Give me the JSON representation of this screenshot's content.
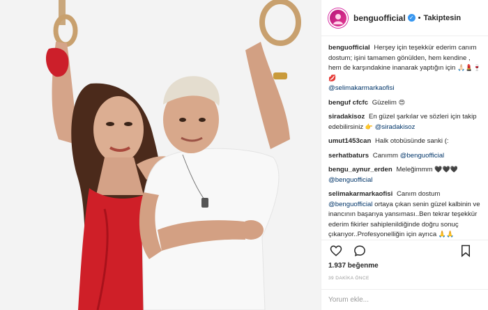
{
  "post": {
    "username": "benguofficial",
    "separator": "•",
    "follow_status": "Takiptesin",
    "likes": "1.937 beğenme",
    "time": "39 DAKİKA ÖNCE",
    "comment_placeholder": "Yorum ekle..."
  },
  "icons": {
    "verified": "verified-badge-icon",
    "like": "heart-icon",
    "comment": "speech-bubble-icon",
    "save": "bookmark-icon",
    "avatar": "profile-avatar"
  },
  "colors": {
    "mention": "#003569",
    "verified": "#3897f0",
    "muted": "#999999"
  },
  "comments": [
    {
      "user": "benguofficial",
      "text": "Herşey için teşekkür ederim canım dostum; işini tamamen gönülden, hem kendine , hem de karşındakine inanarak yaptığın için",
      "emoji": "🙏🏻💄🍷💋",
      "mention": "@selimakarmarkaofisi"
    },
    {
      "user": "benguf cfcfc",
      "text": "Güzelim",
      "emoji": "😍"
    },
    {
      "user": "siradakisoz",
      "text": "En güzel şarkılar ve sözleri için takip edebilirsiniz",
      "emoji": "👉",
      "mention": "@siradakisoz"
    },
    {
      "user": "umut1453can",
      "text": "Halk otobüsünde sanki (:"
    },
    {
      "user": "serhatbaturs",
      "text": "Canımm",
      "mention": "@benguofficial"
    },
    {
      "user": "bengu_aynur_erden",
      "text": "Meleğimmm",
      "emoji": "🖤🖤🖤",
      "mention": "@benguofficial"
    },
    {
      "user": "selimakarmarkaofisi",
      "text": "Canım dostum",
      "mention": "@benguofficial",
      "text2": "ortaya çıkan senin güzel kalbinin ve inancının başarıya yansıması..Ben tekrar teşekkür ederim fikirler sahiplenildiğinde doğru sonuç çıkarıyor..Profesyonelliğin için ayrıca",
      "emoji": "🙏🙏"
    }
  ]
}
